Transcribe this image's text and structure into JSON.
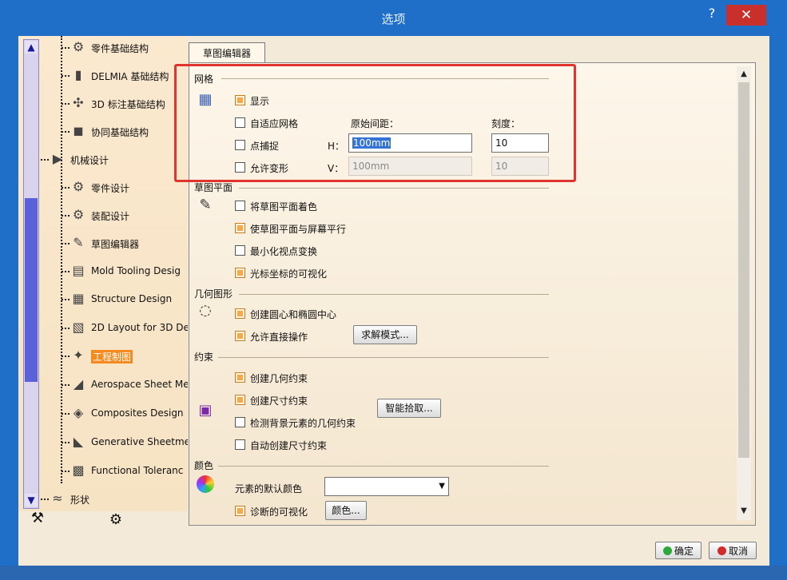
{
  "window": {
    "title": "选项",
    "help": "?",
    "close": "✕"
  },
  "tree": {
    "items": [
      {
        "label": "零件基础结构",
        "icon": "part-infra-icon",
        "glyph": "⚙"
      },
      {
        "label": "DELMIA 基础结构",
        "icon": "delmia-icon",
        "glyph": "▮"
      },
      {
        "label": "3D 标注基础结构",
        "icon": "annotation-icon",
        "glyph": "✣"
      },
      {
        "label": "协同基础结构",
        "icon": "collab-icon",
        "glyph": "◼"
      },
      {
        "label": "机械设计",
        "icon": "mech-design-icon",
        "glyph": "▶"
      },
      {
        "label": "零件设计",
        "icon": "part-design-icon",
        "glyph": "⚙"
      },
      {
        "label": "装配设计",
        "icon": "assembly-icon",
        "glyph": "⚙"
      },
      {
        "label": "草图编辑器",
        "icon": "sketcher-icon",
        "glyph": "✎"
      },
      {
        "label": "Mold Tooling Desig",
        "icon": "mold-icon",
        "glyph": "▤"
      },
      {
        "label": "Structure Design",
        "icon": "structure-icon",
        "glyph": "▦"
      },
      {
        "label": "2D Layout for 3D De",
        "icon": "layout-icon",
        "glyph": "▧"
      },
      {
        "label": "工程制图",
        "icon": "drafting-icon",
        "glyph": "✦"
      },
      {
        "label": "Aerospace Sheet Me",
        "icon": "aero-icon",
        "glyph": "◢"
      },
      {
        "label": "Composites Design",
        "icon": "composites-icon",
        "glyph": "◈"
      },
      {
        "label": "Generative Sheetme",
        "icon": "gen-sheet-icon",
        "glyph": "◣"
      },
      {
        "label": "Functional Toleranc",
        "icon": "tolerance-icon",
        "glyph": "▩"
      },
      {
        "label": "形状",
        "icon": "shape-icon",
        "glyph": "≈"
      }
    ]
  },
  "tabs": [
    {
      "label": "草图编辑器"
    }
  ],
  "grid": {
    "title": "网格",
    "display": "显示",
    "adaptive": "自适应网格",
    "snap": "点捕捉",
    "distort": "允许变形",
    "spacing_label": "原始间距：",
    "graduation_label": "刻度：",
    "h_label": "H：",
    "v_label": "V：",
    "h_spacing": "100mm",
    "v_spacing": "100mm",
    "h_grad": "10",
    "v_grad": "10"
  },
  "plane": {
    "title": "草图平面",
    "shade": "将草图平面着色",
    "parallel": "使草图平面与屏幕平行",
    "minimize": "最小化视点变换",
    "cursor": "光标坐标的可视化"
  },
  "geometry": {
    "title": "几何图形",
    "centers": "创建圆心和椭圆中心",
    "direct": "允许直接操作",
    "solve_btn": "求解模式..."
  },
  "constraint": {
    "title": "约束",
    "geo": "创建几何约束",
    "dim": "创建尺寸约束",
    "detect": "检测背景元素的几何约束",
    "auto": "自动创建尺寸约束",
    "smart_btn": "智能拾取..."
  },
  "colors": {
    "title": "颜色",
    "default_label": "元素的默认颜色",
    "diag": "诊断的可视化",
    "color_btn": "颜色..."
  },
  "footer": {
    "ok": "确定",
    "cancel": "取消"
  },
  "accent": {
    "highlight": "#e0352e",
    "selection": "#f58a1f"
  }
}
